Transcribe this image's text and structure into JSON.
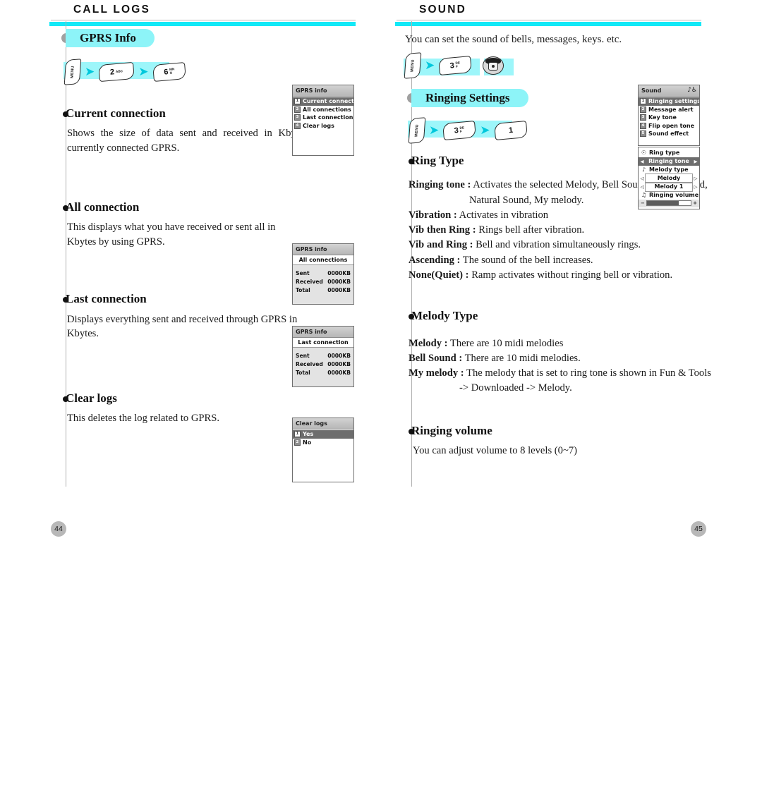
{
  "left_page": {
    "title": "CALL LOGS",
    "page_number": "44",
    "pill": "GPRS Info",
    "key_sequence": [
      {
        "type": "menu",
        "label": "MENU"
      },
      {
        "type": "arrow",
        "label": "➜"
      },
      {
        "type": "num",
        "digit": "2",
        "letters": "ABC"
      },
      {
        "type": "arrow",
        "label": "➜"
      },
      {
        "type": "num",
        "digit": "6",
        "letters": "MNO"
      }
    ],
    "sections": [
      {
        "heading": "Current connection",
        "body": "Shows the size of data sent and received in Kbytes through currently connected GPRS."
      },
      {
        "heading": "All connection",
        "body": "This displays what you have received or sent all in Kbytes by using GPRS."
      },
      {
        "heading": "Last connection",
        "body": "Displays everything sent and received through GPRS in Kbytes."
      },
      {
        "heading": "Clear logs",
        "body": "This deletes the log related to GPRS."
      }
    ],
    "screens": [
      {
        "name": "gprs-info-menu",
        "title": "GPRS info",
        "items": [
          {
            "index": "1",
            "label": "Current connectio",
            "selected": true
          },
          {
            "index": "2",
            "label": "All connections",
            "selected": false
          },
          {
            "index": "3",
            "label": "Last connection",
            "selected": false
          },
          {
            "index": "4",
            "label": "Clear logs",
            "selected": false
          }
        ]
      },
      {
        "name": "all-connections-screen",
        "title": "GPRS info",
        "banner": "All connections",
        "rows": [
          {
            "label": "Sent",
            "value": "0000KB"
          },
          {
            "label": "Received",
            "value": "0000KB"
          },
          {
            "label": "Total",
            "value": "0000KB"
          }
        ]
      },
      {
        "name": "last-connection-screen",
        "title": "GPRS info",
        "banner": "Last connection",
        "rows": [
          {
            "label": "Sent",
            "value": "0000KB"
          },
          {
            "label": "Received",
            "value": "0000KB"
          },
          {
            "label": "Total",
            "value": "0000KB"
          }
        ]
      },
      {
        "name": "clear-logs-screen",
        "title": "Clear logs",
        "items": [
          {
            "index": "1",
            "label": "Yes",
            "selected": true
          },
          {
            "index": "2",
            "label": "No",
            "selected": false
          }
        ]
      }
    ]
  },
  "right_page": {
    "title": "SOUND",
    "page_number": "45",
    "intro": "You can set the sound of bells, messages, keys. etc.",
    "pill": "Ringing Settings",
    "key_sequence_1": [
      {
        "type": "menu",
        "label": "MENU"
      },
      {
        "type": "arrow",
        "label": "➜"
      },
      {
        "type": "num",
        "digit": "3",
        "letters": "DEF"
      },
      {
        "type": "nav",
        "label": "navigation-pad"
      }
    ],
    "key_sequence_2": [
      {
        "type": "menu",
        "label": "MENU"
      },
      {
        "type": "arrow",
        "label": "➜"
      },
      {
        "type": "num",
        "digit": "3",
        "letters": "DEF"
      },
      {
        "type": "arrow",
        "label": "➜"
      },
      {
        "type": "num",
        "digit": "1",
        "letters": ""
      }
    ],
    "sections": [
      {
        "heading": "Ring Type",
        "definitions": [
          {
            "term": "Ringing tone :",
            "desc": "Activates the selected Melody, Bell Sound, Voice Sound,",
            "cont": "Natural Sound, My melody."
          },
          {
            "term": "Vibration :",
            "desc": "Activates in vibration",
            "cont": ""
          },
          {
            "term": "Vib then Ring :",
            "desc": "Rings bell after vibration.",
            "cont": ""
          },
          {
            "term": "Vib and Ring :",
            "desc": "Bell and vibration simultaneously rings.",
            "cont": ""
          },
          {
            "term": "Ascending :",
            "desc": "The sound of the bell increases.",
            "cont": ""
          },
          {
            "term": "None(Quiet) :",
            "desc": "Ramp activates without ringing bell or vibration.",
            "cont": ""
          }
        ]
      },
      {
        "heading": "Melody Type",
        "definitions": [
          {
            "term": "Melody :",
            "desc": "There are 10 midi melodies",
            "cont": ""
          },
          {
            "term": "Bell Sound :",
            "desc": "There are 10 midi melodies.",
            "cont": ""
          },
          {
            "term": "My melody :",
            "desc": "The melody that is set to ring tone is shown in Fun & Tools",
            "cont": "-> Downloaded -> Melody."
          }
        ]
      },
      {
        "heading": "Ringing volume",
        "body": "You can adjust volume to 8 levels (0~7)"
      }
    ],
    "screens": [
      {
        "name": "sound-menu",
        "title": "Sound",
        "title_icon": "ear-sound-icon",
        "items": [
          {
            "index": "1",
            "label": "Ringing settings",
            "selected": true
          },
          {
            "index": "2",
            "label": "Message alert",
            "selected": false
          },
          {
            "index": "3",
            "label": "Key tone",
            "selected": false
          },
          {
            "index": "4",
            "label": "Flip open tone",
            "selected": false
          },
          {
            "index": "5",
            "label": "Sound effect",
            "selected": false
          }
        ]
      },
      {
        "name": "ringing-settings-screen",
        "rows": [
          {
            "kind": "label",
            "icon": "bell-icon",
            "label": "Ring type"
          },
          {
            "kind": "selector",
            "label": "Ringing tone",
            "highlighted": true
          },
          {
            "kind": "label",
            "icon": "note-icon",
            "label": "Melody type"
          },
          {
            "kind": "selector",
            "label": "Melody",
            "highlighted": false
          },
          {
            "kind": "selector",
            "label": "Melody 1",
            "highlighted": false
          },
          {
            "kind": "label",
            "icon": "speaker-icon",
            "label": "Ringing volume"
          },
          {
            "kind": "slider",
            "minus": "−",
            "plus": "+",
            "value": 72
          }
        ]
      }
    ]
  },
  "colors": {
    "accent_cyan": "#13e9f7",
    "pill_cyan": "#8df4f8",
    "band_cyan": "#9df6fa",
    "arrow_cyan": "#00c8dc",
    "page_number_gray": "#b8b8b8",
    "rule_gray": "#b0b0b0"
  }
}
